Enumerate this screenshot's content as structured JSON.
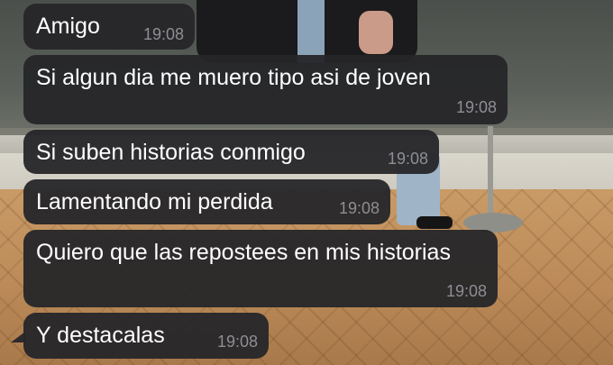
{
  "messages": [
    {
      "text": "Amigo",
      "time": "19:08"
    },
    {
      "text": "Si algun dia me muero tipo asi de joven",
      "time": "19:08"
    },
    {
      "text": "Si suben historias conmigo",
      "time": "19:08"
    },
    {
      "text": "Lamentando mi perdida",
      "time": "19:08"
    },
    {
      "text": "Quiero que las repostees en mis historias",
      "time": "19:08"
    },
    {
      "text": "Y destacalas",
      "time": "19:08"
    }
  ],
  "colors": {
    "bubble": "#262629",
    "message_text": "#ffffff",
    "timestamp": "#8e8e93"
  }
}
